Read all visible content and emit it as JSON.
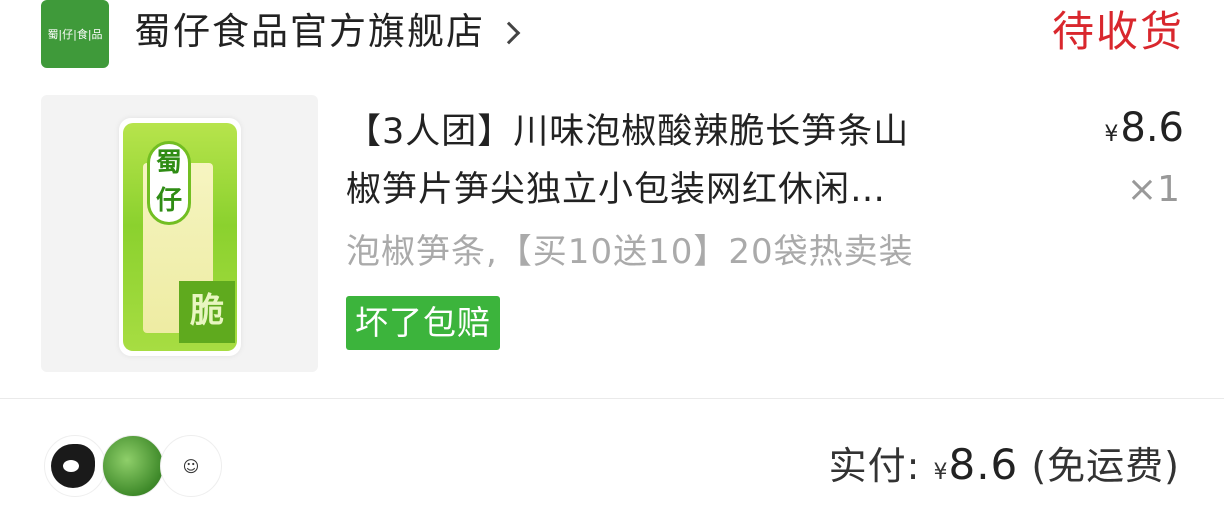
{
  "shop": {
    "logo_text": "蜀|仔|食|品",
    "name": "蜀仔食品官方旗舰店",
    "status": "待收货"
  },
  "product": {
    "title_line1": "【3人团】川味泡椒酸辣脆长笋条山",
    "title_line2": "椒笋片笋尖独立小包装网红休闲…",
    "currency": "¥",
    "price": "8.6",
    "quantity": "×1",
    "sku": "泡椒笋条,【买10送10】20袋热卖装",
    "badge": "坏了包赔",
    "image_brand_text": "蜀仔",
    "image_tag_text": "脆"
  },
  "footer": {
    "avatar_3_icon": "☺",
    "paid_label": "实付: ",
    "currency": "¥",
    "amount": "8.6",
    "shipping_note": " (免运费)"
  },
  "colors": {
    "status_red": "#d9272d",
    "badge_green": "#3cb43c",
    "logo_green": "#3f9a3a"
  }
}
